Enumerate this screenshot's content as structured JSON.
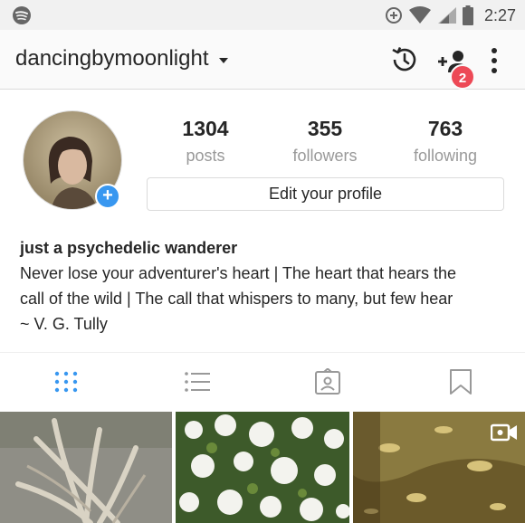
{
  "statusbar": {
    "time": "2:27",
    "icons": [
      "spotify-icon",
      "data-saver-icon",
      "wifi-icon",
      "signal-icon",
      "battery-icon"
    ]
  },
  "header": {
    "username": "dancingbymoonlight",
    "notification_count": "2"
  },
  "profile": {
    "posts": {
      "count": "1304",
      "label": "posts"
    },
    "followers": {
      "count": "355",
      "label": "followers"
    },
    "following": {
      "count": "763",
      "label": "following"
    },
    "edit_label": "Edit your profile"
  },
  "bio": {
    "name": "just a psychedelic wanderer",
    "lines": [
      "Never lose your adventurer's heart | The heart that hears the",
      "call of the wild | The call that whispers to many, but few hear",
      "~ V. G. Tully"
    ]
  },
  "tabs": [
    "grid-view",
    "list-view",
    "tagged",
    "saved"
  ],
  "colors": {
    "accent": "#3897f0",
    "badge": "#ed4956",
    "muted": "#999999",
    "border": "#dbdbdb"
  }
}
